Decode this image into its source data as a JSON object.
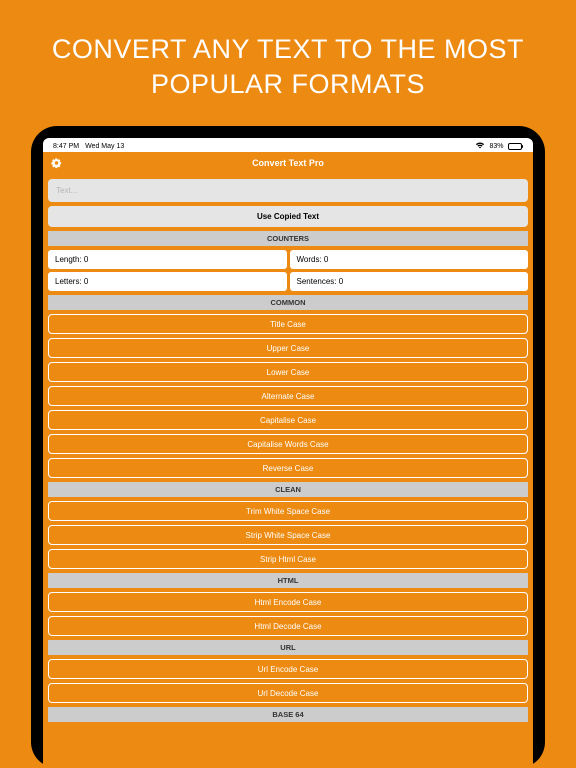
{
  "promo_heading": "CONVERT ANY TEXT TO THE MOST POPULAR FORMATS",
  "status": {
    "time": "8:47 PM",
    "date": "Wed May 13",
    "battery_pct": "83%"
  },
  "header": {
    "title": "Convert Text Pro"
  },
  "input": {
    "placeholder": "Text..."
  },
  "use_copied_label": "Use Copied Text",
  "sections": {
    "counters": {
      "title": "COUNTERS",
      "cells": {
        "length": "Length: 0",
        "words": "Words: 0",
        "letters": "Letters: 0",
        "sentences": "Sentences: 0"
      }
    },
    "common": {
      "title": "COMMON",
      "ops": [
        "Title Case",
        "Upper Case",
        "Lower Case",
        "Alternate Case",
        "Capitalise Case",
        "Capitalise Words Case",
        "Reverse Case"
      ]
    },
    "clean": {
      "title": "CLEAN",
      "ops": [
        "Trim White Space Case",
        "Strip White Space Case",
        "Strip Html Case"
      ]
    },
    "html": {
      "title": "HTML",
      "ops": [
        "Html Encode Case",
        "Html Decode Case"
      ]
    },
    "url": {
      "title": "URL",
      "ops": [
        "Url Encode Case",
        "Url Decode Case"
      ]
    },
    "base64": {
      "title": "BASE 64",
      "ops": []
    }
  }
}
